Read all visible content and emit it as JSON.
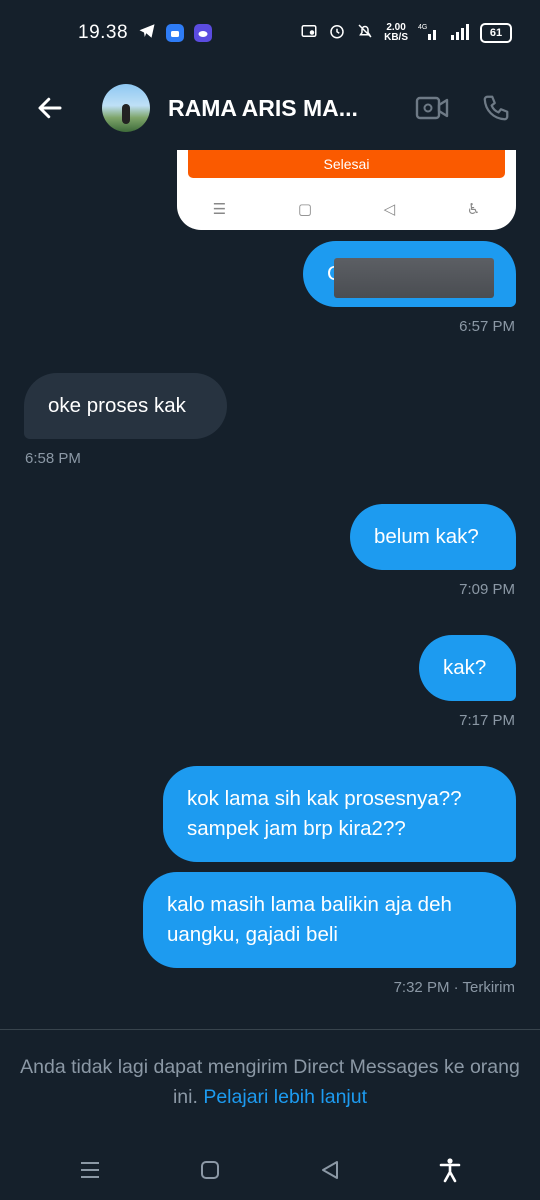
{
  "status_bar": {
    "time": "19.38",
    "speed_value": "2.00",
    "speed_unit": "KB/S",
    "network": "4G",
    "battery": "61",
    "icons": [
      "telegram-icon",
      "android-app-icon",
      "weather-app-icon",
      "screen-record-icon",
      "alarm-icon",
      "mute-icon",
      "signal-icon",
      "wifi-icon",
      "battery-icon"
    ]
  },
  "header": {
    "title": "RAMA ARIS MA...",
    "icons": [
      "back-arrow-icon",
      "video-call-icon",
      "phone-call-icon"
    ]
  },
  "preview": {
    "button_label": "Selesai",
    "nav_glyphs": [
      "☰",
      "▢",
      "◁",
      "♿"
    ]
  },
  "messages": [
    {
      "direction": "out",
      "text": "C",
      "note": "redacted"
    },
    {
      "direction": "timestamp",
      "text": "6:57 PM"
    },
    {
      "direction": "in",
      "text": "oke proses kak"
    },
    {
      "direction": "timestamp",
      "text": "6:58 PM"
    },
    {
      "direction": "out",
      "text": "belum kak?"
    },
    {
      "direction": "timestamp",
      "text": "7:09 PM"
    },
    {
      "direction": "out",
      "text": "kak?"
    },
    {
      "direction": "timestamp",
      "text": "7:17 PM"
    },
    {
      "direction": "out",
      "text": "kok lama sih kak prosesnya?? sampek jam brp kira2??"
    },
    {
      "direction": "out",
      "text": "kalo masih lama balikin aja deh uangku, gajadi beli"
    },
    {
      "direction": "timestamp",
      "text": "7:32 PM · Terkirim"
    }
  ],
  "footer": {
    "notice": "Anda tidak lagi dapat mengirim Direct Messages ke orang ini.",
    "link": "Pelajari lebih lanjut"
  },
  "colors": {
    "background": "#15202b",
    "outgoing_bubble": "#1d9bf0",
    "incoming_bubble": "#273340",
    "muted_text": "#8b98a5",
    "link": "#1d9bf0",
    "preview_button": "#fa5a00"
  }
}
